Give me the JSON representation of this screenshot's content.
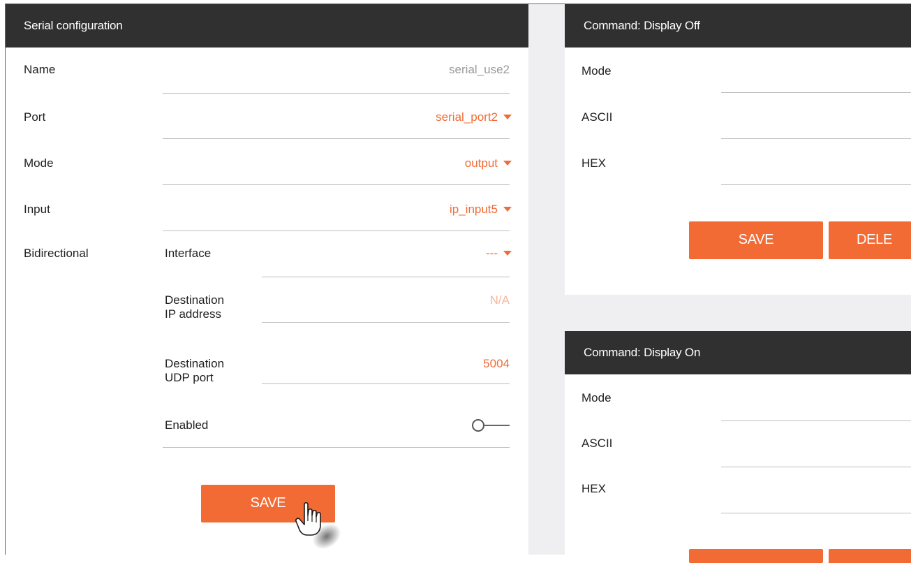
{
  "serial_config": {
    "title": "Serial configuration",
    "name_label": "Name",
    "name_value": "serial_use2",
    "port_label": "Port",
    "port_value": "serial_port2",
    "mode_label": "Mode",
    "mode_value": "output",
    "input_label": "Input",
    "input_value": "ip_input5",
    "bidirectional_label": "Bidirectional",
    "interface_label": "Interface",
    "interface_value": "---",
    "dest_ip_label_line1": "Destination",
    "dest_ip_label_line2": "IP address",
    "dest_ip_value": "N/A",
    "dest_udp_label_line1": "Destination",
    "dest_udp_label_line2": "UDP port",
    "dest_udp_value": "5004",
    "enabled_label": "Enabled",
    "enabled_state": false,
    "save_label": "SAVE"
  },
  "command_display_off": {
    "title": "Command: Display Off",
    "mode_label": "Mode",
    "ascii_label": "ASCII",
    "hex_label": "HEX",
    "save_label": "SAVE",
    "delete_label": "DELE"
  },
  "command_display_on": {
    "title": "Command: Display On",
    "mode_label": "Mode",
    "ascii_label": "ASCII",
    "hex_label": "HEX"
  },
  "colors": {
    "accent": "#f26b35",
    "header_bg": "#303030",
    "separator_bg": "#efeef0"
  },
  "icons": {
    "dropdown": "caret-down-icon",
    "cursor": "hand-pointer-icon"
  }
}
